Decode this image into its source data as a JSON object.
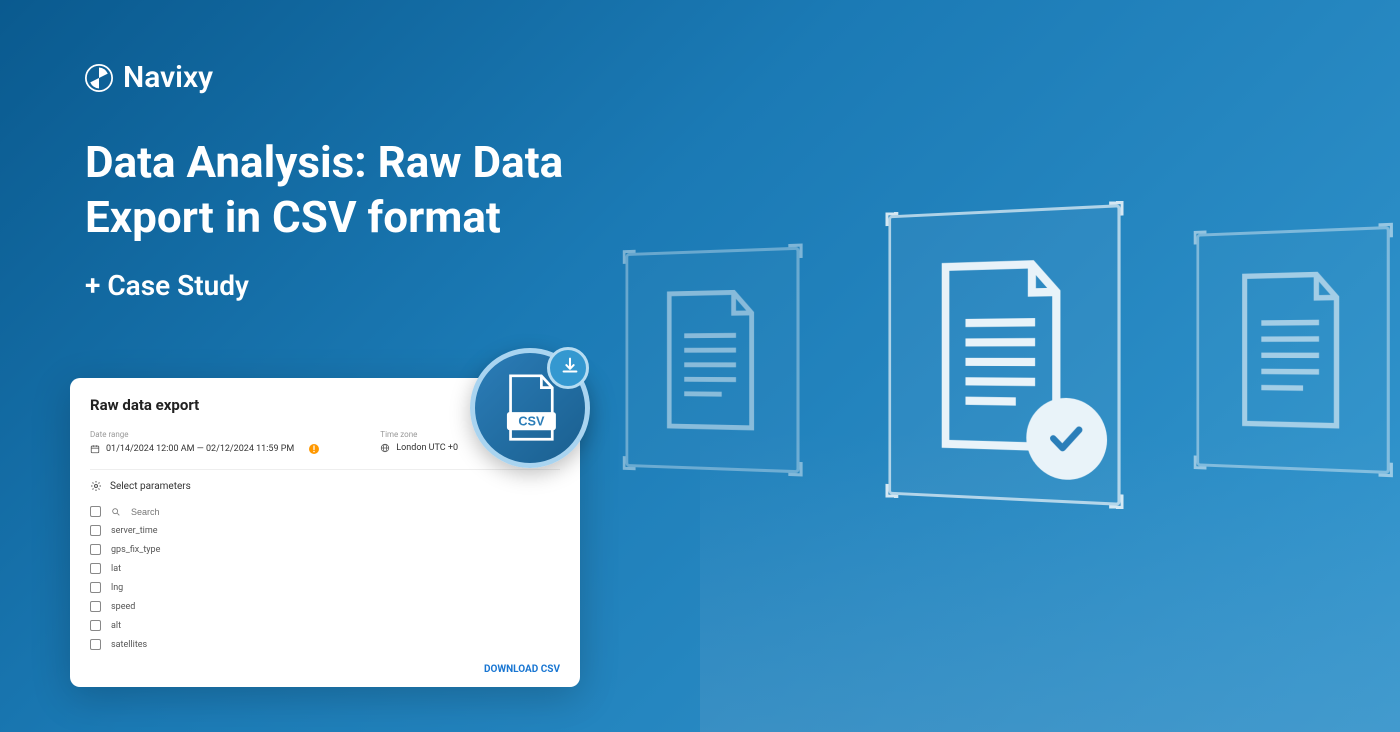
{
  "brand": {
    "name": "Navixy"
  },
  "hero": {
    "title_line1": "Data Analysis: Raw Data",
    "title_line2": "Export in CSV format",
    "subtitle": "+ Case Study"
  },
  "panel": {
    "title": "Raw data export",
    "date_range_label": "Date range",
    "date_range_value": "01/14/2024 12:00 AM — 02/12/2024 11:59 PM",
    "timezone_label": "Time zone",
    "timezone_value": "London UTC +0",
    "params_header": "Select parameters",
    "search_placeholder": "Search",
    "parameters": [
      "server_time",
      "gps_fix_type",
      "lat",
      "lng",
      "speed",
      "alt",
      "satellites"
    ],
    "download_label": "DOWNLOAD CSV"
  },
  "csv_badge": {
    "label": "CSV"
  }
}
